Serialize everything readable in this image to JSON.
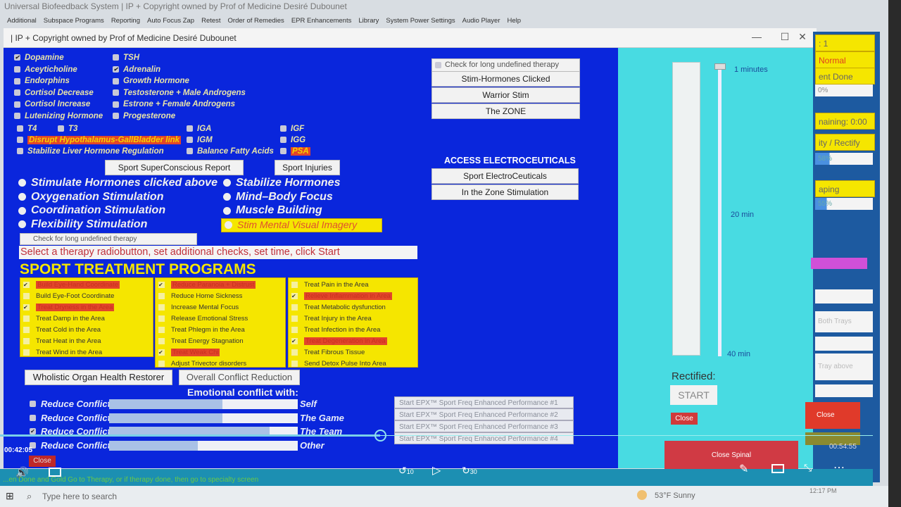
{
  "app_title": "Universal Biofeedback System | IP + Copyright owned by Prof of Medicine Desiré Dubounet",
  "menu": [
    "Additional",
    "Subspace Programs",
    "Reporting",
    "Auto Focus Zap",
    "Retest",
    "Order of Remedies",
    "EPR Enhancements",
    "Library",
    "System Power Settings",
    "Audio Player",
    "Help"
  ],
  "window": {
    "title": "| IP + Copyright owned by Prof of Medicine Desiré Dubounet",
    "controls": [
      "—",
      "☐",
      "✕"
    ]
  },
  "hormones_col1": [
    {
      "label": "Dopamine",
      "checked": true
    },
    {
      "label": "Aceyticholine",
      "checked": false
    },
    {
      "label": "Endorphins",
      "checked": false
    },
    {
      "label": "Cortisol Decrease",
      "checked": false
    },
    {
      "label": "Cortisol Increase",
      "checked": false
    },
    {
      "label": "Lutenizing Hormone",
      "checked": false
    }
  ],
  "hormones_col2": [
    {
      "label": "TSH",
      "checked": false
    },
    {
      "label": "Adrenalin",
      "checked": true
    },
    {
      "label": "Growth Hormone",
      "checked": false
    },
    {
      "label": "Testosterone + Male Androgens",
      "checked": false
    },
    {
      "label": "Estrone + Female Androgens",
      "checked": false
    },
    {
      "label": "Progesterone",
      "checked": false
    }
  ],
  "hormones_row": {
    "t4": "T4",
    "t3": "T3",
    "disrupt": "Disrupt Hypothalamus-GallBladder link",
    "liver": "Stabilize Liver Hormone Regulation",
    "iga": "IGA",
    "igm": "IGM",
    "fatty": "Balance Fatty Acids",
    "igf": "IGF",
    "igg": "IGG",
    "psa": "PSA"
  },
  "buttons": {
    "superconscious": "Sport SuperConscious Report",
    "injuries": "Sport Injuries",
    "check_long": "Check for long undefined therapy",
    "stim_hormones": "Stim-Hormones Clicked",
    "warrior": "Warrior Stim",
    "zone": "The ZONE",
    "access_title": "ACCESS ELECTROCEUTICALS",
    "sport_electro": "Sport ElectroCeuticals",
    "in_zone": "In the Zone Stimulation",
    "wholistic": "Wholistic Organ Health Restorer",
    "overall": "Overall Conflict Reduction",
    "close": "Close"
  },
  "radios_left": [
    "Stimulate Hormones clicked above",
    "Oxygenation Stimulation",
    "Coordination Stimulation",
    "Flexibility Stimulation"
  ],
  "radios_right": [
    "Stabilize Hormones",
    "Mind–Body Focus",
    "Muscle Building",
    "Stim Mental Visual Imagery"
  ],
  "check_long_left": "Check for long undefined therapy",
  "instruction": "Select a therapy radiobutton, set additional checks, set time, click Start",
  "programs_title": "SPORT TREATMENT PROGRAMS",
  "programs": [
    [
      {
        "label": "Build Eye-Hand Coordinate",
        "checked": true
      },
      {
        "label": "Build Eye-Foot Coordinate",
        "checked": false
      },
      {
        "label": "Treat Dryness in the Area",
        "checked": true
      },
      {
        "label": "Treat Damp in the Area",
        "checked": false
      },
      {
        "label": "Treat Cold in the Area",
        "checked": false
      },
      {
        "label": "Treat Heat in the Area",
        "checked": false
      },
      {
        "label": "Treat Wind in the Area",
        "checked": false
      }
    ],
    [
      {
        "label": "Reduce Paranoia + Distrust",
        "checked": true
      },
      {
        "label": "Reduce Home Sickness",
        "checked": false
      },
      {
        "label": "Increase Mental Focus",
        "checked": false
      },
      {
        "label": "Release Emotional Stress",
        "checked": false
      },
      {
        "label": "Treat Phlegm in the Area",
        "checked": false
      },
      {
        "label": "Treat Energy Stagnation",
        "checked": false
      },
      {
        "label": "Treat Weak Chi",
        "checked": true
      },
      {
        "label": "Adjust Trivector disorders",
        "checked": false
      }
    ],
    [
      {
        "label": "Treat Pain in the Area",
        "checked": false
      },
      {
        "label": "Relieve Inflammation in Area",
        "checked": true
      },
      {
        "label": "Treat Metabolic dysfunction",
        "checked": false
      },
      {
        "label": "Treat Injury in the Area",
        "checked": false
      },
      {
        "label": "Treat Infection in the Area",
        "checked": false
      },
      {
        "label": "Treat Degeneration in Area",
        "checked": true
      },
      {
        "label": "Treat Fibrous Tissue",
        "checked": false
      },
      {
        "label": "Send Detox Pulse Into Area",
        "checked": false
      }
    ]
  ],
  "conflict": {
    "title": "Emotional conflict with:",
    "rows": [
      {
        "label": "Reduce Conflict",
        "target": "Self",
        "checked": false,
        "level": 0.6
      },
      {
        "label": "Reduce Conflict",
        "target": "The Game",
        "checked": false,
        "level": 0.6
      },
      {
        "label": "Reduce Conflict",
        "target": "The Team",
        "checked": true,
        "level": 0.85
      },
      {
        "label": "Reduce Conflict",
        "target": "Other",
        "checked": false,
        "level": 0.47
      }
    ]
  },
  "epx": [
    "Start EPX™ Sport Freq Enhanced Performance #1",
    "Start EPX™ Sport Freq Enhanced Performance #2",
    "Start EPX™ Sport Freq Enhanced Performance #3",
    "Start EPX™ Sport Freq Enhanced Performance #4"
  ],
  "timer": {
    "top": "1 minutes",
    "mid": "20 min",
    "bottom": "40 min",
    "rectified": "Rectified:",
    "start": "START",
    "close": "Close",
    "close_spinal": "Close Spinal"
  },
  "right_strip": {
    "r1": ": 1",
    "r2": "Normal",
    "r3": "ent Done",
    "p1": "0%",
    "r4": "naining: 0:00",
    "r5": "ity / Rectify",
    "p2": "58%",
    "r6": "aping",
    "p3": "55%",
    "w2": "Both Trays",
    "w4": "Tray above",
    "close": "Close",
    "time": "00:54:55"
  },
  "video": {
    "elapsed": "00:42:05",
    "progress": 0.42,
    "subtitle": "...en Done and Gold Go to Therapy, or if therapy done, then go to specialty screen",
    "rewind": "10",
    "forward": "30"
  },
  "taskbar": {
    "search": "Type here to search",
    "weather": "53°F Sunny",
    "time": "12:17 PM"
  },
  "colors": {
    "panel": "#0a26dc",
    "cyan": "#48dbe2",
    "yellow": "#f5e600",
    "highlight": "#e2452a"
  }
}
